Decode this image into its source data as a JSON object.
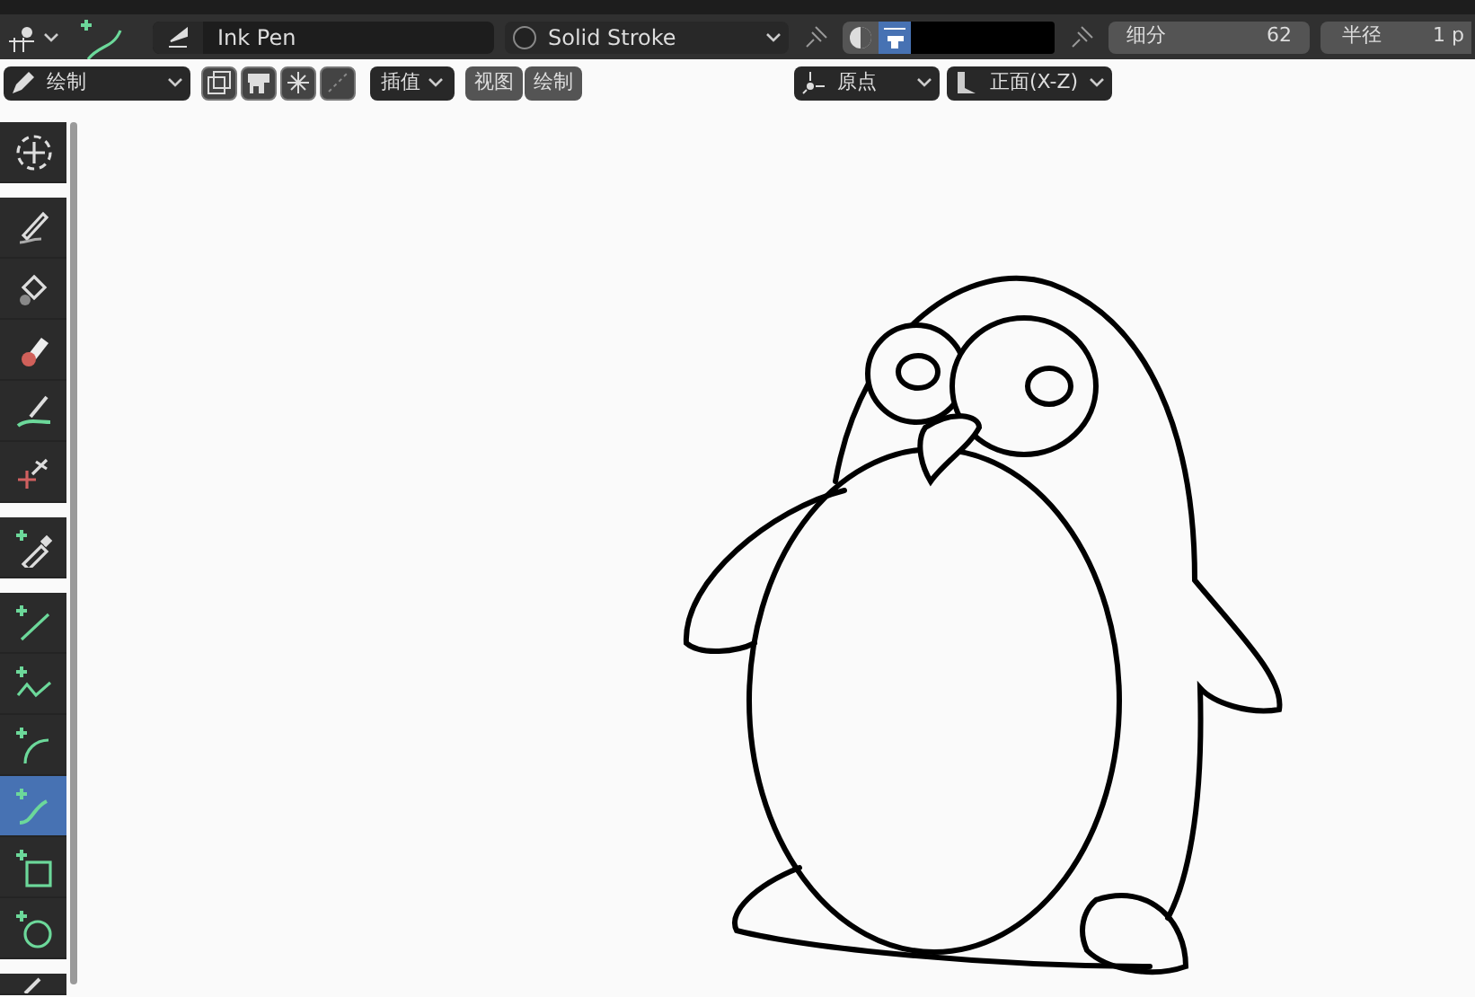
{
  "header": {
    "brush": "Ink Pen",
    "material": "Solid Stroke",
    "subdivision": {
      "label": "细分",
      "value": "62"
    },
    "radius": {
      "label": "半径",
      "value": "1 p"
    }
  },
  "viewport_header": {
    "mode": "绘制",
    "toggles": [
      {
        "selected": false
      },
      {
        "selected": false
      },
      {
        "selected": false
      },
      {
        "selected": false
      }
    ],
    "interpolate": "插值",
    "menus": [
      "视图",
      "绘制"
    ],
    "pivot": "原点",
    "orientation": "正面(X-Z)"
  },
  "tool_groups": [
    {
      "tools": [
        {
          "kind": "cursor",
          "selected": false
        }
      ]
    },
    {
      "tools": [
        {
          "kind": "draw",
          "selected": false
        },
        {
          "kind": "fill",
          "selected": false
        },
        {
          "kind": "erase",
          "selected": false
        },
        {
          "kind": "tint",
          "selected": false
        },
        {
          "kind": "cutter",
          "selected": false
        }
      ]
    },
    {
      "tools": [
        {
          "kind": "eyedropper",
          "selected": false
        }
      ]
    },
    {
      "tools": [
        {
          "kind": "line",
          "selected": false
        },
        {
          "kind": "polyline",
          "selected": false
        },
        {
          "kind": "arc",
          "selected": false
        },
        {
          "kind": "curve",
          "selected": true
        },
        {
          "kind": "box",
          "selected": false
        },
        {
          "kind": "circle",
          "selected": false
        }
      ]
    },
    {
      "tools": [
        {
          "kind": "annotate",
          "selected": false
        }
      ]
    }
  ]
}
